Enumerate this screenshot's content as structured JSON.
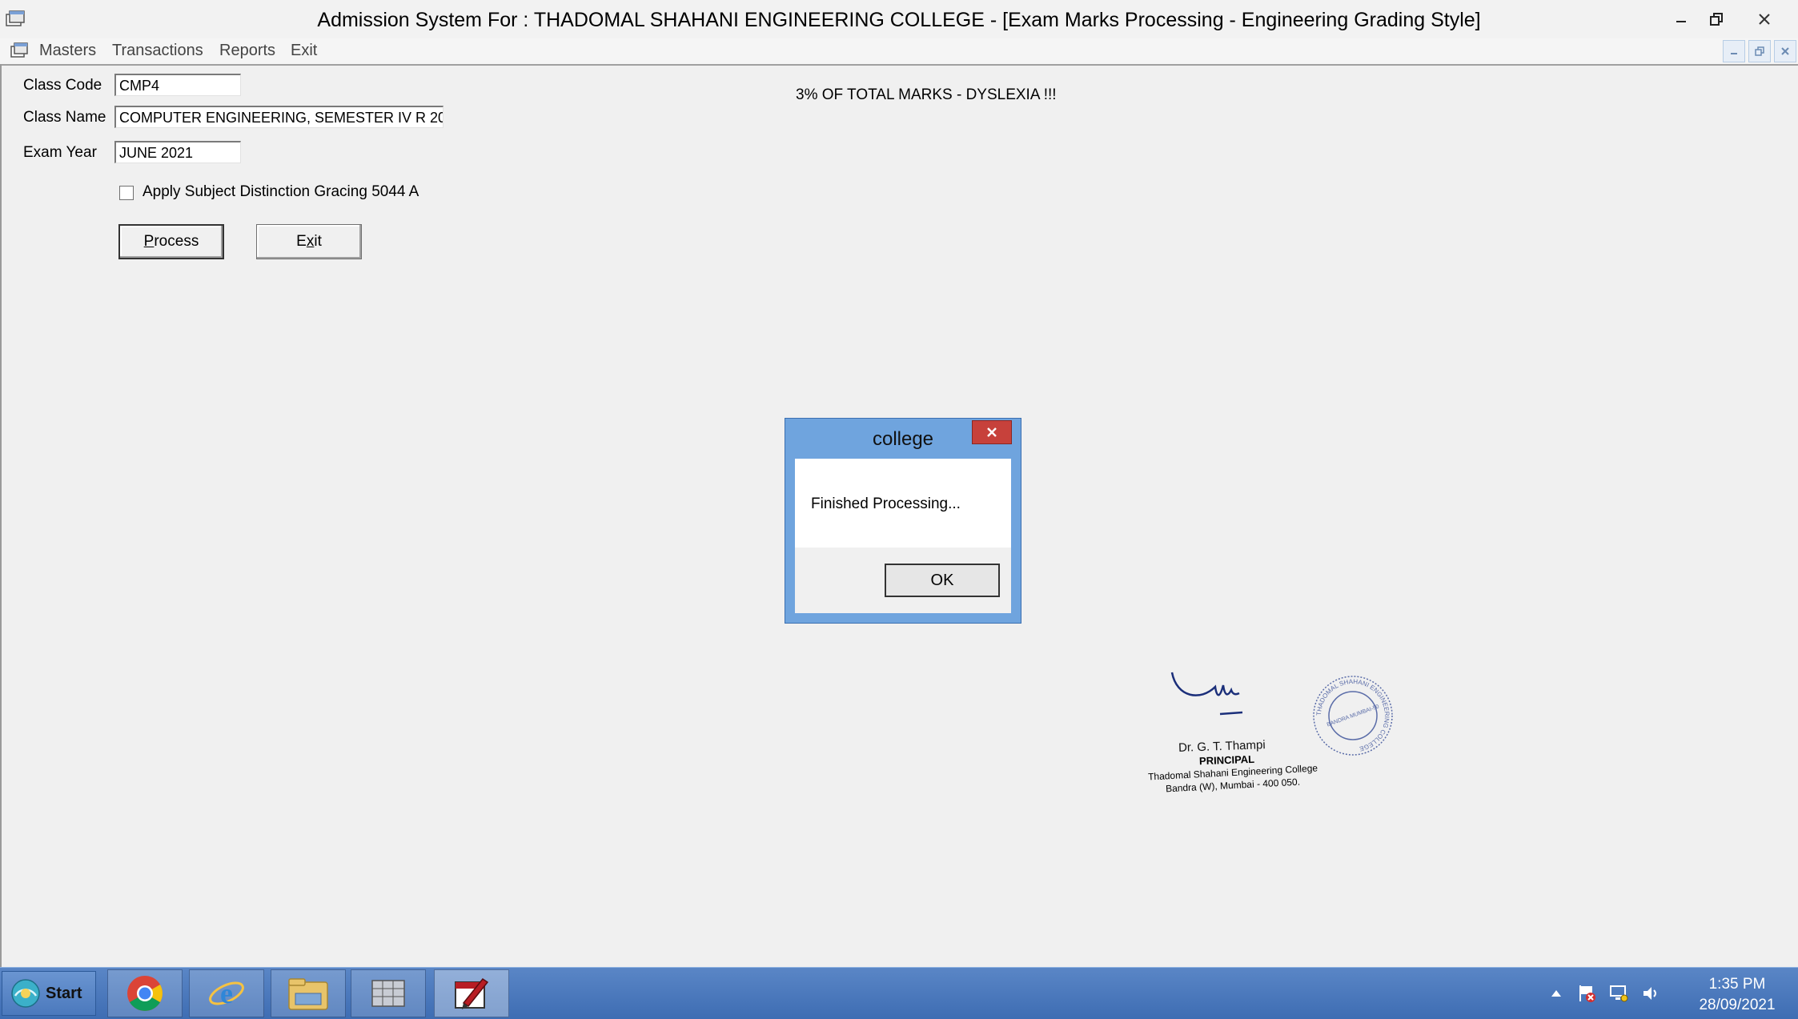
{
  "window": {
    "title": "Admission System For : THADOMAL SHAHANI ENGINEERING COLLEGE - [Exam Marks Processing - Engineering Grading Style]",
    "controls": [
      "minimize-icon",
      "restore-icon",
      "close-icon"
    ]
  },
  "menu": {
    "items": [
      "Masters",
      "Transactions",
      "Reports",
      "Exit"
    ]
  },
  "form": {
    "class_code_label": "Class Code",
    "class_code_value": "CMP4",
    "class_name_label": "Class Name",
    "class_name_value": "COMPUTER ENGINEERING, SEMESTER IV R 20",
    "exam_year_label": "Exam Year",
    "exam_year_value": "JUNE 2021",
    "checkbox_label": "Apply Subject Distinction Gracing 5044 A",
    "checkbox_checked": false,
    "process_prefix": "",
    "process_mnemonic": "P",
    "process_rest": "rocess",
    "exit_prefix": "E",
    "exit_mnemonic": "x",
    "exit_rest": "it",
    "notice": "3% OF TOTAL MARKS - DYSLEXIA !!!"
  },
  "dialog": {
    "title": "college",
    "message": "Finished Processing...",
    "ok_label": "OK"
  },
  "signature": {
    "name": "Dr. G. T. Thampi",
    "role": "PRINCIPAL",
    "college": "Thadomal Shahani Engineering College",
    "address": "Bandra (W), Mumbai - 400 050.",
    "seal_text": "THADOMAL SHAHANI ENGINEERING COLLEGE",
    "seal_center": "BANDRA MUMBAI-50"
  },
  "taskbar": {
    "start_label": "Start",
    "apps": [
      "chrome-icon",
      "internet-explorer-icon",
      "file-explorer-icon",
      "app-grid-icon",
      "admission-app-icon"
    ],
    "tray": [
      "show-hidden-icon",
      "action-center-flag-icon",
      "network-icon",
      "volume-icon"
    ],
    "time": "1:35 PM",
    "date": "28/09/2021"
  },
  "colors": {
    "dialog_frame": "#6fa4de",
    "close_red": "#c7413b",
    "taskbar_blue": "#4a78bc",
    "signature_ink": "#1b2f7a"
  }
}
